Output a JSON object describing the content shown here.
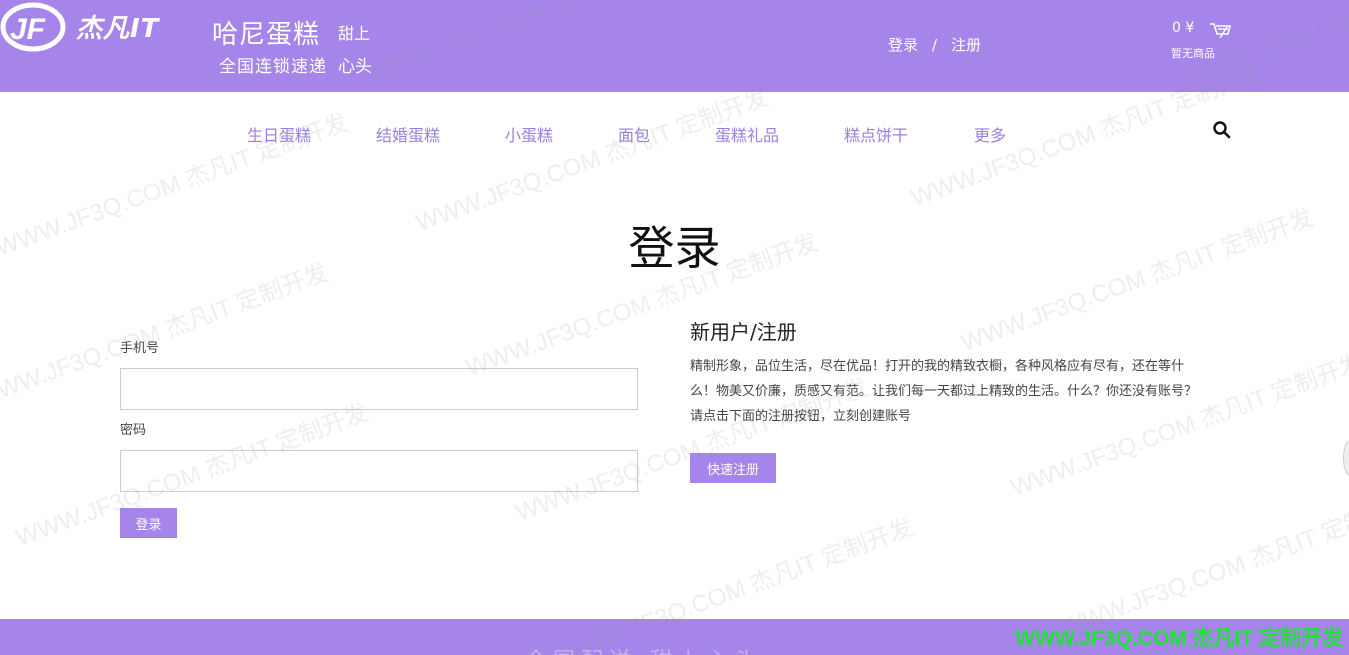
{
  "header": {
    "logo_text": "杰凡IT",
    "shop_name": "哈尼蛋糕",
    "slogan_small": "甜上",
    "slogan_line2": "全国连锁速递",
    "slogan_line2b": "心头",
    "auth_login": "登录",
    "auth_sep": "/",
    "auth_register": "注册",
    "cart_total": "0 ¥",
    "cart_empty": "暂无商品"
  },
  "nav": {
    "items": [
      "生日蛋糕",
      "结婚蛋糕",
      "小蛋糕",
      "面包",
      "蛋糕礼品",
      "糕点饼干",
      "更多"
    ]
  },
  "page": {
    "title": "登录"
  },
  "login_form": {
    "phone_label": "手机号",
    "phone_value": "",
    "password_label": "密码",
    "password_value": "",
    "submit_label": "登录"
  },
  "register": {
    "title": "新用户/注册",
    "description": "精制形象，品位生活，尽在优品！打开的我的精致衣橱，各种风格应有尽有，还在等什么！物美又价廉，质感又有范。让我们每一天都过上精致的生活。什么？你还没有账号？请点击下面的注册按钮，立刻创建账号",
    "button_label": "快速注册"
  },
  "footer": {
    "faint_text": "全国配送 甜上心头"
  },
  "watermark": {
    "text": "WWW.JF3Q.COM 杰凡IT  定制开发",
    "corner": "WWW.JF3Q.COM 杰凡IT  定制开发"
  },
  "colors": {
    "brand": "#a585ea",
    "nav_text": "#9b7fe0",
    "corner_watermark": "#22e03a"
  },
  "icons": [
    "logo-jf-icon",
    "cart-icon",
    "search-icon"
  ]
}
